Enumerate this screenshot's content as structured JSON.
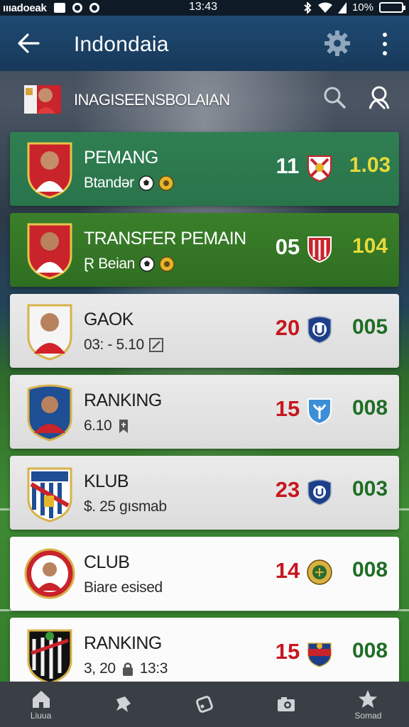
{
  "status_bar": {
    "carrier": "ıııadoeak",
    "time": "13:43",
    "battery": "10%"
  },
  "app_bar": {
    "title": "Indondaia"
  },
  "sub_header": {
    "brand": "INAGISEENSBOLAIAN"
  },
  "cards": [
    {
      "title": "PEMANG",
      "subtitle": "Btandər",
      "number": "11",
      "score": "1.03",
      "style": "green1"
    },
    {
      "title": "TRANSFER PEMAIN",
      "subtitle": "Ɽ Beian",
      "number": "05",
      "score": "104",
      "style": "green2"
    },
    {
      "title": "GAOK",
      "subtitle": "03: - 5.10",
      "number": "20",
      "score": "005",
      "style": "light"
    },
    {
      "title": "RANKING",
      "subtitle": "6.10",
      "number": "15",
      "score": "008",
      "style": "light"
    },
    {
      "title": "KLUB",
      "subtitle": "$. 25 gısmab",
      "number": "23",
      "score": "003",
      "style": "light"
    },
    {
      "title": "CLUB",
      "subtitle": "Biare esised",
      "number": "14",
      "score": "008",
      "style": "white"
    },
    {
      "title": "RANKING",
      "subtitle": "3, 20",
      "subtitle2": "13:3",
      "number": "15",
      "score": "008",
      "style": "white"
    }
  ],
  "bottom_nav": [
    {
      "label": "Liuua",
      "icon": "home-icon"
    },
    {
      "label": "",
      "icon": "pin-icon"
    },
    {
      "label": "",
      "icon": "tag-icon"
    },
    {
      "label": "",
      "icon": "camera-icon"
    },
    {
      "label": "Somad",
      "icon": "star-icon"
    }
  ]
}
